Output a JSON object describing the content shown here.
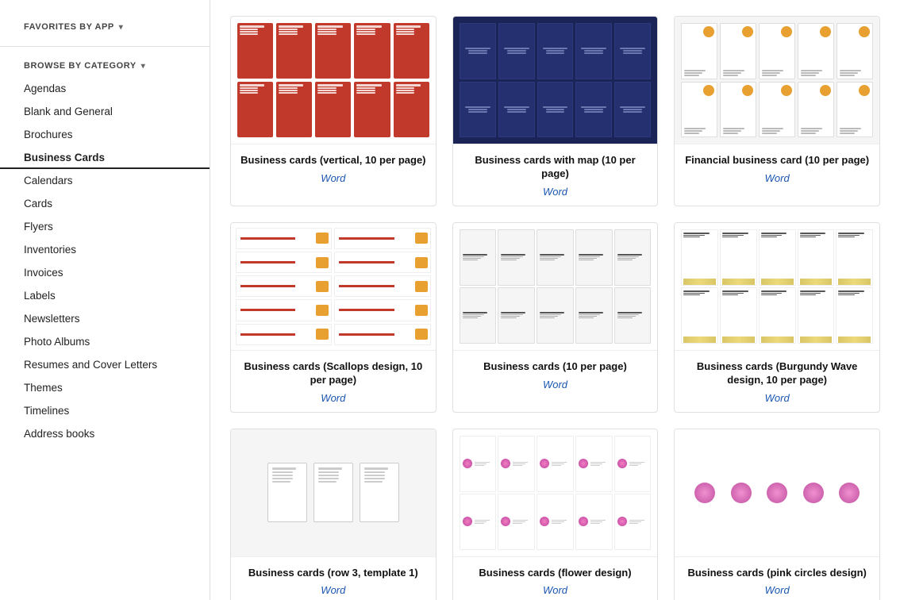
{
  "sidebar": {
    "favorites_label": "FAVORITES BY APP",
    "browse_label": "BROWSE BY CATEGORY",
    "items": [
      {
        "label": "Agendas",
        "id": "agendas",
        "active": false
      },
      {
        "label": "Blank and General",
        "id": "blank-general",
        "active": false
      },
      {
        "label": "Brochures",
        "id": "brochures",
        "active": false
      },
      {
        "label": "Business Cards",
        "id": "business-cards",
        "active": true
      },
      {
        "label": "Calendars",
        "id": "calendars",
        "active": false
      },
      {
        "label": "Cards",
        "id": "cards",
        "active": false
      },
      {
        "label": "Flyers",
        "id": "flyers",
        "active": false
      },
      {
        "label": "Inventories",
        "id": "inventories",
        "active": false
      },
      {
        "label": "Invoices",
        "id": "invoices",
        "active": false
      },
      {
        "label": "Labels",
        "id": "labels",
        "active": false
      },
      {
        "label": "Newsletters",
        "id": "newsletters",
        "active": false
      },
      {
        "label": "Photo Albums",
        "id": "photo-albums",
        "active": false
      },
      {
        "label": "Resumes and Cover Letters",
        "id": "resumes",
        "active": false
      },
      {
        "label": "Themes",
        "id": "themes",
        "active": false
      },
      {
        "label": "Timelines",
        "id": "timelines",
        "active": false
      },
      {
        "label": "Address books",
        "id": "address-books",
        "active": false
      }
    ]
  },
  "templates": [
    {
      "id": "bc-vertical-10",
      "title": "Business cards (vertical, 10 per page)",
      "app": "Word",
      "preview_type": "orange-grid"
    },
    {
      "id": "bc-map-10",
      "title": "Business cards with map (10 per page)",
      "app": "Word",
      "preview_type": "dark-blue-grid"
    },
    {
      "id": "bc-financial-10",
      "title": "Financial business card (10 per page)",
      "app": "Word",
      "preview_type": "financial-grid"
    },
    {
      "id": "bc-scallops-10",
      "title": "Business cards (Scallops design, 10 per page)",
      "app": "Word",
      "preview_type": "scallops-grid"
    },
    {
      "id": "bc-10page",
      "title": "Business cards (10 per page)",
      "app": "Word",
      "preview_type": "plain-10page"
    },
    {
      "id": "bc-burgundy-10",
      "title": "Business cards (Burgundy Wave design, 10 per page)",
      "app": "Word",
      "preview_type": "burgundy-grid"
    },
    {
      "id": "bc-row3-1",
      "title": "Business cards (row 3, template 1)",
      "app": "Word",
      "preview_type": "row3-vertical"
    },
    {
      "id": "bc-flowers-pink",
      "title": "Business cards (flower design)",
      "app": "Word",
      "preview_type": "flowers-grid"
    },
    {
      "id": "bc-pink-circles",
      "title": "Business cards (pink circles design)",
      "app": "Word",
      "preview_type": "pink-circles"
    }
  ]
}
